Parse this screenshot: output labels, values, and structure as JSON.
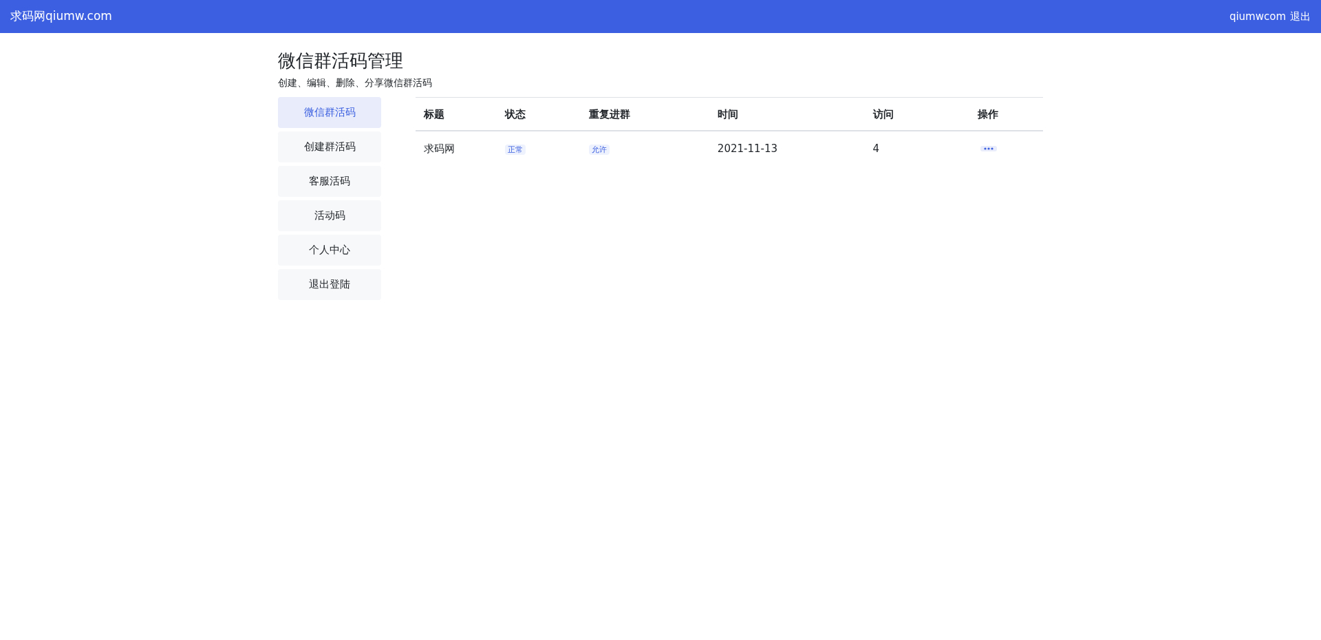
{
  "navbar": {
    "brand": "求码网qiumw.com",
    "user": "qiumwcom",
    "logout": "退出"
  },
  "page": {
    "title": "微信群活码管理",
    "subtitle": "创建、编辑、删除、分享微信群活码"
  },
  "sidebar": {
    "items": [
      {
        "label": "微信群活码",
        "selected": true
      },
      {
        "label": "创建群活码",
        "selected": false
      },
      {
        "label": "客服活码",
        "selected": false
      },
      {
        "label": "活动码",
        "selected": false
      },
      {
        "label": "个人中心",
        "selected": false
      },
      {
        "label": "退出登陆",
        "selected": false
      }
    ]
  },
  "table": {
    "columns": [
      "标题",
      "状态",
      "重复进群",
      "时间",
      "访问",
      "操作"
    ],
    "rows": [
      {
        "title": "求码网",
        "status": "正常",
        "repeat_join": "允许",
        "time": "2021-11-13",
        "visits": "4"
      }
    ]
  }
}
